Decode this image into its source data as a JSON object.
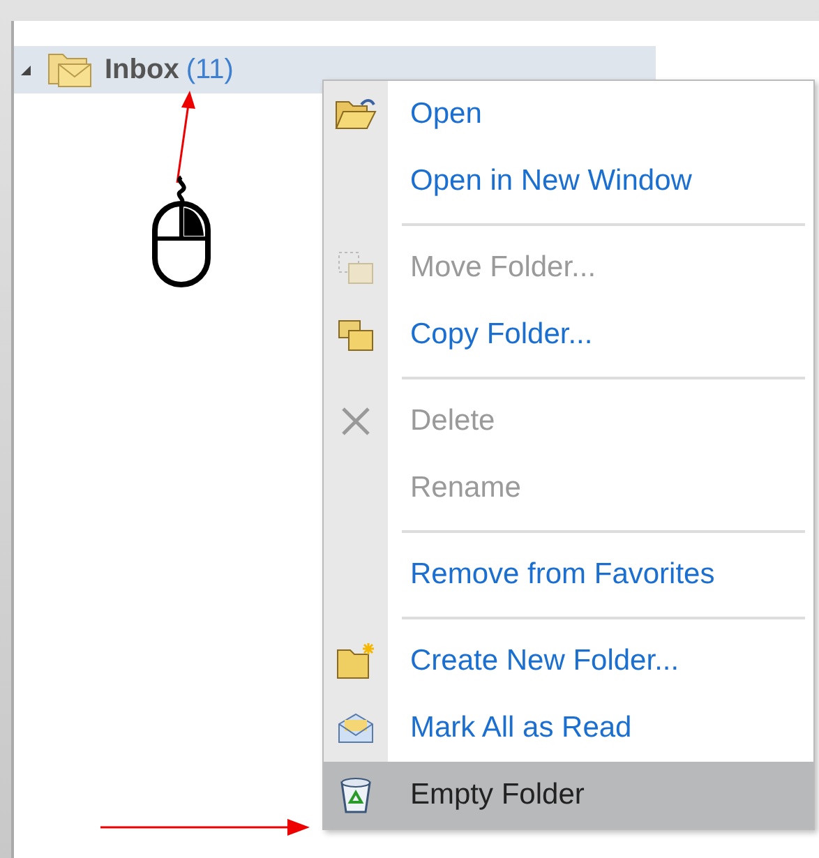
{
  "folder": {
    "name": "Inbox",
    "count": "(11)",
    "expanded": true,
    "selected": true
  },
  "menu": [
    {
      "kind": "item",
      "label": "Open",
      "disabled": false,
      "selected": false
    },
    {
      "kind": "item",
      "label": "Open in New Window",
      "disabled": false,
      "selected": false
    },
    {
      "kind": "separator"
    },
    {
      "kind": "item",
      "label": "Move Folder...",
      "disabled": true,
      "selected": false
    },
    {
      "kind": "item",
      "label": "Copy Folder...",
      "disabled": false,
      "selected": false
    },
    {
      "kind": "separator"
    },
    {
      "kind": "item",
      "label": "Delete",
      "disabled": true,
      "selected": false
    },
    {
      "kind": "item",
      "label": "Rename",
      "disabled": true,
      "selected": false
    },
    {
      "kind": "separator"
    },
    {
      "kind": "item",
      "label": "Remove from Favorites",
      "disabled": false,
      "selected": false
    },
    {
      "kind": "separator"
    },
    {
      "kind": "item",
      "label": "Create New Folder...",
      "disabled": false,
      "selected": false
    },
    {
      "kind": "item",
      "label": "Mark All as Read",
      "disabled": false,
      "selected": false
    },
    {
      "kind": "item",
      "label": "Empty Folder",
      "disabled": false,
      "selected": true
    }
  ]
}
